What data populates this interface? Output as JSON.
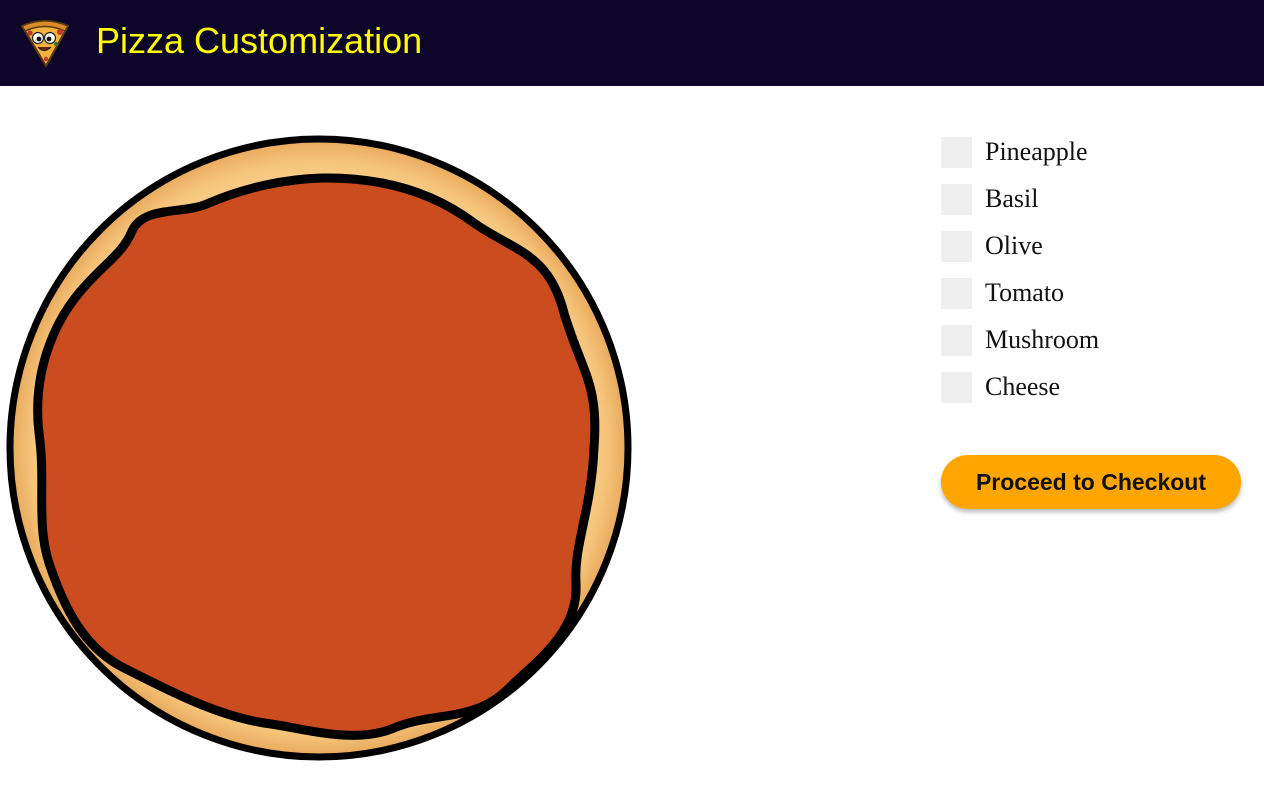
{
  "header": {
    "title": "Pizza Customization",
    "logo_icon": "pizza-slice-icon",
    "background": "#0d0628",
    "title_color": "#ffff00"
  },
  "pizza": {
    "icon": "pizza-base-icon",
    "crust_color": "#f2c47c",
    "sauce_color": "#cb4c1e"
  },
  "toppings": [
    {
      "label": "Pineapple",
      "checked": false
    },
    {
      "label": "Basil",
      "checked": false
    },
    {
      "label": "Olive",
      "checked": false
    },
    {
      "label": "Tomato",
      "checked": false
    },
    {
      "label": "Mushroom",
      "checked": false
    },
    {
      "label": "Cheese",
      "checked": false
    }
  ],
  "checkout": {
    "label": "Proceed to Checkout",
    "color": "#ffa500"
  }
}
